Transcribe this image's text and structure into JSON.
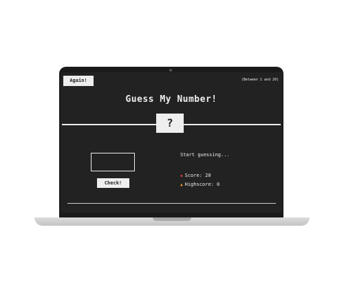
{
  "game": {
    "again_label": "Again!",
    "range_note": "(Between 1 and 20)",
    "title": "Guess My Number!",
    "secret_display": "?",
    "guess_value": "",
    "check_label": "Check!",
    "message": "Start guessing...",
    "score_label": "Score:",
    "score_value": "20",
    "highscore_label": "Highscore:",
    "highscore_value": "0"
  },
  "icons": {
    "score": "score-icon",
    "highscore": "highscore-icon"
  },
  "colors": {
    "background": "#222222",
    "text": "#eeeeee",
    "score_icon": "#e04040",
    "highscore_icon": "#f0a020"
  }
}
